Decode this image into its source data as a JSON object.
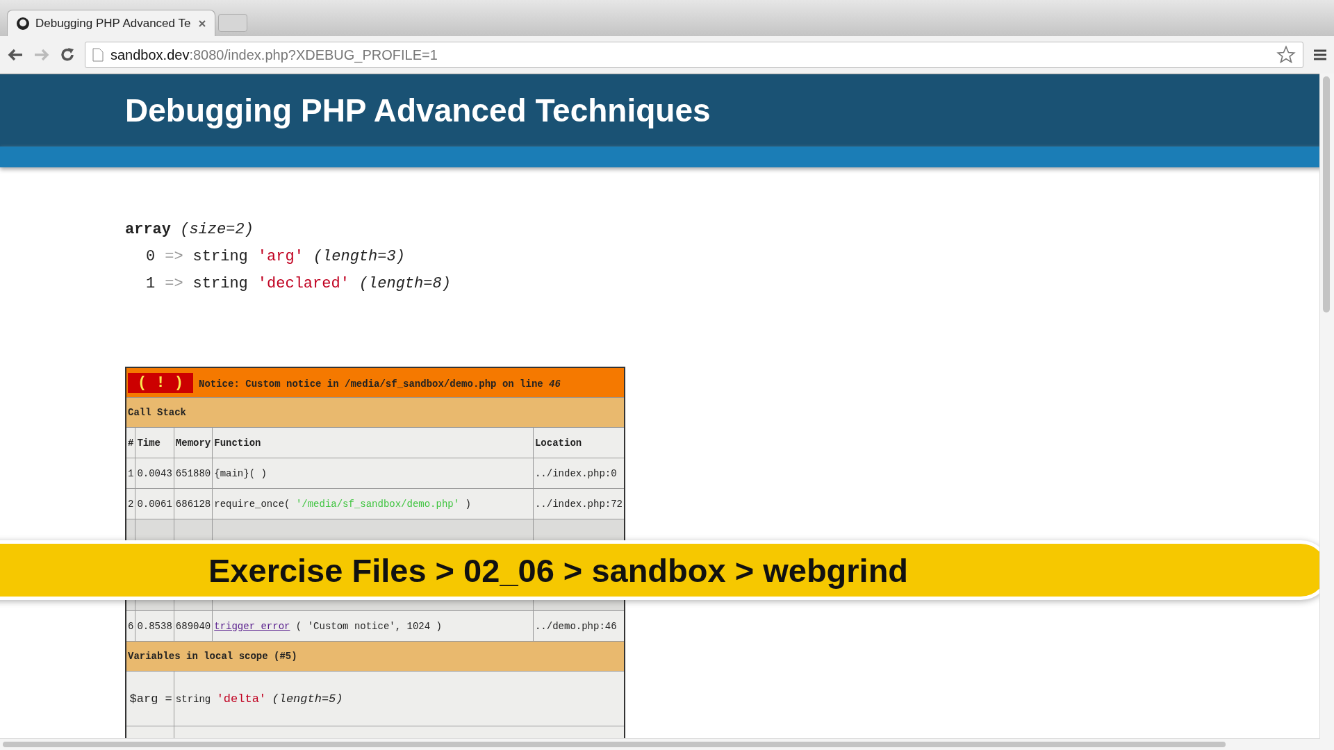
{
  "browser": {
    "tab": {
      "title": "Debugging PHP Advanced Te",
      "selected": true
    },
    "url_host": "sandbox.dev",
    "url_rest": ":8080/index.php?XDEBUG_PROFILE=1"
  },
  "header": {
    "title": "Debugging PHP Advanced Techniques"
  },
  "dump": {
    "type": "array",
    "meta": "(size=2)",
    "items": [
      {
        "key": "0",
        "arrow": "=>",
        "type": "string",
        "value": "'arg'",
        "meta": "(length=3)"
      },
      {
        "key": "1",
        "arrow": "=>",
        "type": "string",
        "value": "'declared'",
        "meta": "(length=8)"
      }
    ]
  },
  "notice": {
    "icon": "( ! )",
    "message": "Notice: Custom notice in /media/sf_sandbox/demo.php on line ",
    "line": "46",
    "call_stack_title": "Call Stack",
    "columns": [
      "#",
      "Time",
      "Memory",
      "Function",
      "Location"
    ],
    "rows": [
      {
        "kind": "call",
        "num": "1",
        "time": "0.0043",
        "memory": "651880",
        "function": "{main}( )",
        "location": "../index.php:0"
      },
      {
        "kind": "call",
        "num": "2",
        "time": "0.0061",
        "memory": "686128",
        "function": "require_once( ",
        "arg": "'/media/sf_sandbox/demo.php'",
        "tail": " )",
        "location": "../index.php:72"
      },
      {
        "kind": "covered"
      },
      {
        "kind": "covered"
      },
      {
        "kind": "covered"
      },
      {
        "kind": "call",
        "num": "6",
        "time": "0.8538",
        "memory": "689040",
        "link": "trigger_error",
        "function": " ( 'Custom notice', 1024 )",
        "location": "../demo.php:46"
      }
    ],
    "vars_title": "Variables in local scope (#5)",
    "vars": [
      {
        "name": "$arg =",
        "type": "string",
        "value": "'delta'",
        "meta": "(length=5)"
      }
    ]
  },
  "banner": {
    "text": "Exercise Files > 02_06 > sandbox > webgrind"
  }
}
